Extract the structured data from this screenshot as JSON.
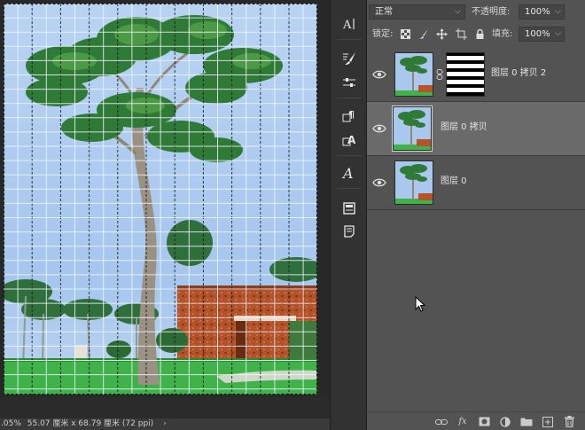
{
  "status_bar": {
    "zoom": ".05%",
    "doc_size": "55.07 厘米 x 68.79 厘米 (72 ppi)",
    "arrow": "›"
  },
  "tool_strip": {
    "items": [
      {
        "name": "character-icon",
        "glyph": "A|"
      },
      {
        "name": "brush-settings-icon",
        "glyph": "brush"
      },
      {
        "name": "brush-presets-icon",
        "glyph": "sliders"
      },
      {
        "name": "paragraph-styles-icon",
        "glyph": "para"
      },
      {
        "name": "character-styles-icon",
        "glyph": "charstyle"
      },
      {
        "name": "glyphs-icon",
        "glyph": "glyph"
      },
      {
        "name": "properties-icon",
        "glyph": "props"
      },
      {
        "name": "notes-icon",
        "glyph": "notes"
      }
    ]
  },
  "layers": {
    "blend_mode": "正常",
    "opacity_label": "不透明度:",
    "opacity_value": "100%",
    "lock_label": "锁定:",
    "fill_label": "填充:",
    "fill_value": "100%",
    "items": [
      {
        "name": "图层 0 拷贝 2",
        "visible": true,
        "selected": false,
        "has_mask": true
      },
      {
        "name": "图层 0 拷贝",
        "visible": true,
        "selected": true,
        "has_mask": false
      },
      {
        "name": "图层 0",
        "visible": true,
        "selected": false,
        "has_mask": false
      }
    ]
  },
  "footer_buttons": [
    {
      "name": "link-layers-icon"
    },
    {
      "name": "fx-icon",
      "label": "fx"
    },
    {
      "name": "add-mask-icon"
    },
    {
      "name": "adjustment-layer-icon"
    },
    {
      "name": "new-group-icon"
    },
    {
      "name": "new-layer-icon"
    },
    {
      "name": "delete-layer-icon"
    }
  ],
  "colors": {
    "panel_bg": "#535353",
    "selected_row": "#6a6a6a",
    "canvas_bg": "#282828",
    "sky": "#a9c9ef",
    "grass": "#3fb24a",
    "brick": "#b5532b"
  }
}
